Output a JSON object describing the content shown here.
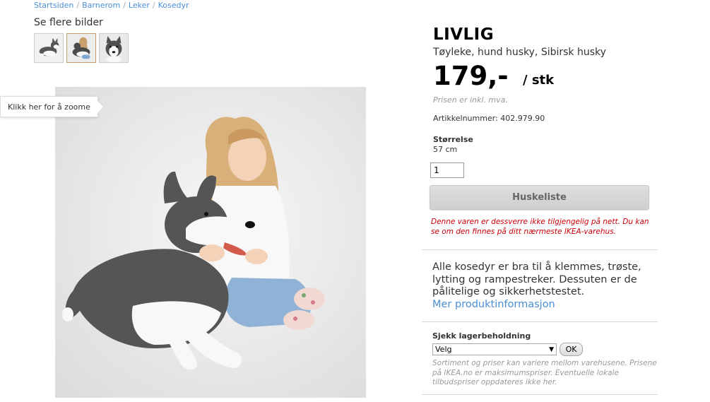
{
  "breadcrumb": [
    {
      "label": "Startsiden"
    },
    {
      "label": "Barnerom"
    },
    {
      "label": "Leker"
    },
    {
      "label": "Kosedyr"
    }
  ],
  "gallery": {
    "heading": "Se flere bilder",
    "thumbnails": [
      {
        "icon": "husky-thumbnail-1"
      },
      {
        "icon": "husky-thumbnail-girl"
      },
      {
        "icon": "husky-thumbnail-face"
      }
    ],
    "selected_index": 1,
    "zoom_tooltip": "Klikk her for å zoome"
  },
  "product": {
    "name": "LIVLIG",
    "type": "Tøyleke, hund husky, Sibirsk husky",
    "price": "179,-",
    "unit": "/ stk",
    "vat_note": "Prisen er inkl. mva.",
    "article_number": "Artikkelnummer: 402.979.90",
    "size_label": "Størrelse",
    "size_value": "57 cm",
    "quantity": "1",
    "wishlist_button": "Huskeliste",
    "unavailable_msg": "Denne varen er dessverre ikke tilgjengelig på nett. Du kan se om den finnes på ditt nærmeste IKEA-varehus.",
    "description": "Alle kosedyr er bra til å klemmes, trøste, lytting og rampestreker. Dessuten er de pålitelige og sikkerhetstestet.",
    "more_info_link": "Mer produktinformasjon"
  },
  "stock": {
    "label": "Sjekk lagerbeholdning",
    "select_value": "Velg",
    "ok_button": "OK",
    "note": "Sortiment og priser kan variere mellom varehusene. Prisene på IKEA.no er maksimumspriser. Eventuelle lokale tilbudspriser oppdateres ikke her."
  },
  "colors": {
    "link": "#4a8fd6",
    "error": "#cc0008",
    "muted": "#999999"
  }
}
